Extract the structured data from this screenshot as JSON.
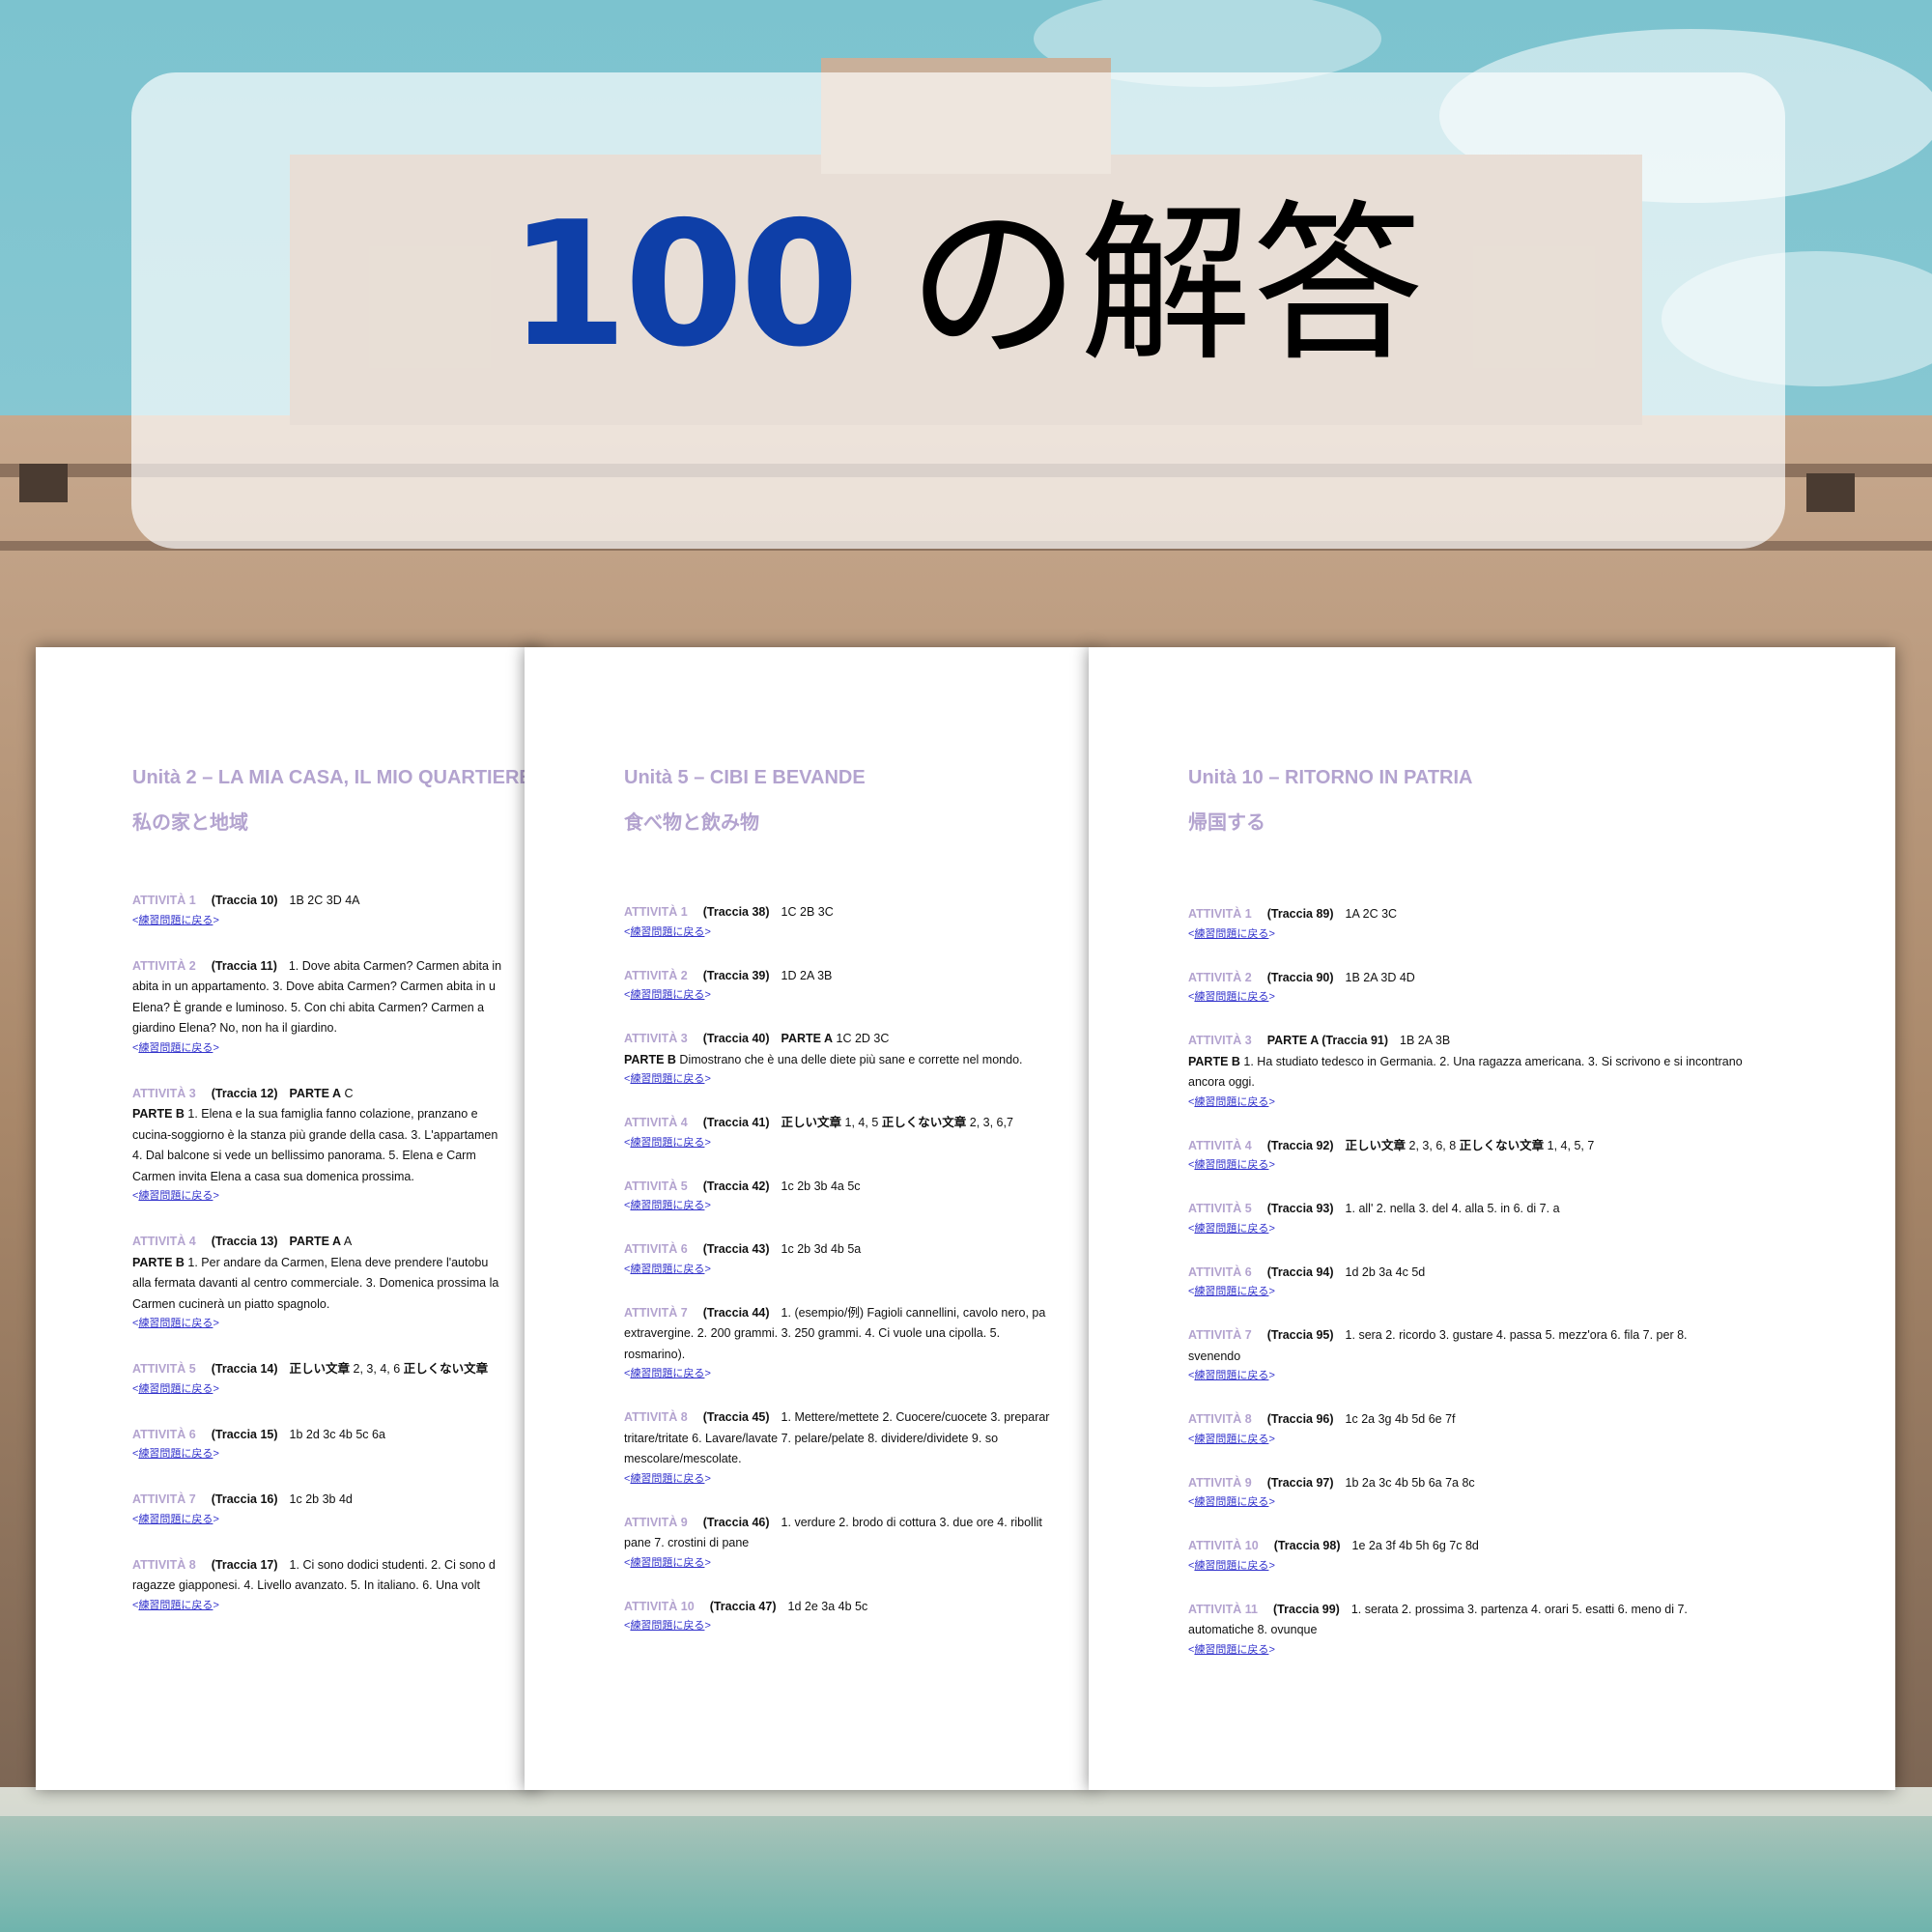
{
  "title": {
    "number": "100",
    "rest": "の解答"
  },
  "back_label": "練習問題に戻る",
  "colors": {
    "accent_blue": "#0e3fa8",
    "heading_lilac": "#b3a3cf",
    "link": "#3333cc"
  },
  "pages": [
    {
      "unit_title": "Unità 2 – LA MIA CASA, IL MIO QUARTIERE",
      "unit_subtitle": "私の家と地域",
      "activities": [
        {
          "label": "ATTIVITÀ 1",
          "traccia": "(Traccia 10)",
          "lines": [
            "1B   2C   3D   4A"
          ]
        },
        {
          "label": "ATTIVITÀ 2",
          "traccia": "(Traccia 11)",
          "lines": [
            "1. Dove abita Carmen? Carmen abita in",
            "abita in un appartamento.   3. Dove abita Carmen? Carmen abita in u",
            "Elena? È grande e luminoso.   5. Con chi abita Carmen? Carmen a",
            "giardino Elena? No, non ha il giardino."
          ]
        },
        {
          "label": "ATTIVITÀ 3",
          "traccia": "(Traccia 12)",
          "lines": [
            "PARTE A   C",
            "PARTE B   1. Elena e la sua famiglia fanno colazione, pranzano e",
            "cucina-soggiorno è la stanza più grande della casa.   3. L'appartamen",
            "4. Dal balcone si vede un bellissimo panorama.   5. Elena e Carm",
            "Carmen invita Elena a casa sua domenica prossima."
          ]
        },
        {
          "label": "ATTIVITÀ 4",
          "traccia": "(Traccia 13)",
          "lines": [
            "PARTE A   A",
            "PARTE B   1. Per andare da Carmen, Elena deve prendere l'autobu",
            "alla fermata davanti al centro commerciale.   3. Domenica prossima la",
            "Carmen cucinerà un piatto spagnolo."
          ]
        },
        {
          "label": "ATTIVITÀ 5",
          "traccia": "(Traccia 14)",
          "lines": [
            "正しい文章   2, 3, 4, 6     正しくない文章"
          ]
        },
        {
          "label": "ATTIVITÀ 6",
          "traccia": "(Traccia 15)",
          "lines": [
            "1b   2d   3c   4b   5c   6a"
          ]
        },
        {
          "label": "ATTIVITÀ 7",
          "traccia": "(Traccia 16)",
          "lines": [
            "1c   2b   3b   4d"
          ]
        },
        {
          "label": "ATTIVITÀ 8",
          "traccia": "(Traccia 17)",
          "lines": [
            "1. Ci sono dodici studenti.   2. Ci sono d",
            "ragazze giapponesi.   4. Livello avanzato.   5. In italiano.   6. Una volt"
          ]
        }
      ]
    },
    {
      "unit_title": "Unità 5 – CIBI E BEVANDE",
      "unit_subtitle": "食べ物と飲み物",
      "activities": [
        {
          "label": "ATTIVITÀ 1",
          "traccia": "(Traccia 38)",
          "lines": [
            "1C   2B   3C"
          ]
        },
        {
          "label": "ATTIVITÀ 2",
          "traccia": "(Traccia 39)",
          "lines": [
            "1D   2A   3B"
          ]
        },
        {
          "label": "ATTIVITÀ 3",
          "traccia": "(Traccia 40)",
          "lines": [
            "PARTE A   1C   2D   3C",
            "PARTE B   Dimostrano che è una delle diete più sane e corrette nel mondo."
          ]
        },
        {
          "label": "ATTIVITÀ 4",
          "traccia": "(Traccia 41)",
          "lines": [
            "正しい文章   1, 4, 5     正しくない文章   2, 3, 6,7"
          ]
        },
        {
          "label": "ATTIVITÀ 5",
          "traccia": "(Traccia 42)",
          "lines": [
            "1c   2b   3b   4a   5c"
          ]
        },
        {
          "label": "ATTIVITÀ 6",
          "traccia": "(Traccia 43)",
          "lines": [
            "1c   2b   3d   4b   5a"
          ]
        },
        {
          "label": "ATTIVITÀ 7",
          "traccia": "(Traccia 44)",
          "lines": [
            "1. (esempio/例) Fagioli cannellini, cavolo nero, pa",
            "extravergine.   2. 200 grammi.   3. 250 grammi.   4. Ci vuole una cipolla.   5.",
            "rosmarino)."
          ]
        },
        {
          "label": "ATTIVITÀ 8",
          "traccia": "(Traccia 45)",
          "lines": [
            "1. Mettere/mettete   2. Cuocere/cuocete   3. preparar",
            "tritare/tritate   6. Lavare/lavate   7. pelare/pelate   8. dividere/dividete   9. so",
            "mescolare/mescolate."
          ]
        },
        {
          "label": "ATTIVITÀ 9",
          "traccia": "(Traccia 46)",
          "lines": [
            "1. verdure   2. brodo di cottura   3. due ore   4. ribollit",
            "pane   7. crostini di pane"
          ]
        },
        {
          "label": "ATTIVITÀ 10",
          "traccia": "(Traccia 47)",
          "lines": [
            "1d   2e   3a   4b   5c"
          ]
        }
      ]
    },
    {
      "unit_title": "Unità 10 – RITORNO IN PATRIA",
      "unit_subtitle": "帰国する",
      "activities": [
        {
          "label": "ATTIVITÀ 1",
          "traccia": "(Traccia 89)",
          "lines": [
            "1A   2C   3C"
          ]
        },
        {
          "label": "ATTIVITÀ 2",
          "traccia": "(Traccia 90)",
          "lines": [
            "1B   2A   3D   4D"
          ]
        },
        {
          "label": "ATTIVITÀ 3",
          "traccia": "PARTE A   (Traccia 91)",
          "lines": [
            "1B   2A   3B",
            "PARTE B   1. Ha studiato tedesco in Germania.   2. Una ragazza americana.   3. Si scrivono e si incontrano",
            "ancora oggi."
          ]
        },
        {
          "label": "ATTIVITÀ 4",
          "traccia": "(Traccia 92)",
          "lines": [
            "正しい文章   2, 3, 6, 8     正しくない文章   1, 4, 5, 7"
          ]
        },
        {
          "label": "ATTIVITÀ 5",
          "traccia": "(Traccia 93)",
          "lines": [
            "1. all'   2. nella   3. del   4. alla   5. in   6. di   7. a"
          ]
        },
        {
          "label": "ATTIVITÀ 6",
          "traccia": "(Traccia 94)",
          "lines": [
            "1d   2b   3a   4c   5d"
          ]
        },
        {
          "label": "ATTIVITÀ 7",
          "traccia": "(Traccia 95)",
          "lines": [
            "1. sera   2. ricordo   3. gustare   4. passa   5. mezz'ora   6. fila   7. per   8.",
            "svenendo"
          ]
        },
        {
          "label": "ATTIVITÀ 8",
          "traccia": "(Traccia 96)",
          "lines": [
            "1c   2a   3g   4b   5d   6e   7f"
          ]
        },
        {
          "label": "ATTIVITÀ 9",
          "traccia": "(Traccia 97)",
          "lines": [
            "1b   2a   3c   4b   5b   6a   7a   8c"
          ]
        },
        {
          "label": "ATTIVITÀ 10",
          "traccia": "(Traccia 98)",
          "lines": [
            "1e   2a   3f   4b   5h   6g   7c   8d"
          ]
        },
        {
          "label": "ATTIVITÀ 11",
          "traccia": "(Traccia 99)",
          "lines": [
            "1. serata   2. prossima   3. partenza   4. orari   5. esatti   6. meno di   7.",
            "automatiche   8. ovunque"
          ]
        }
      ]
    }
  ]
}
